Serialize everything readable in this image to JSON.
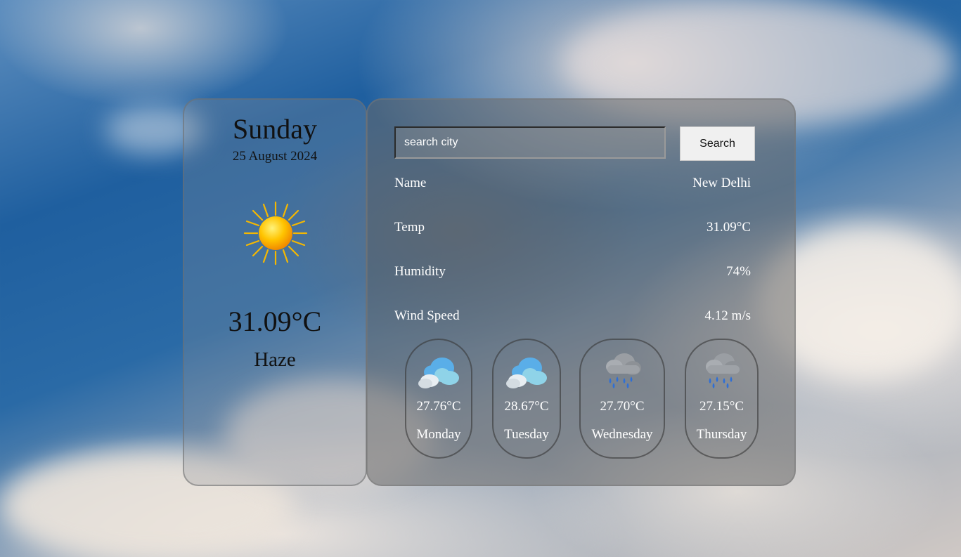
{
  "today": {
    "day": "Sunday",
    "date": "25 August 2024",
    "icon": "sun-icon",
    "temperature": "31.09°C",
    "condition": "Haze"
  },
  "search": {
    "placeholder": "search city",
    "value": "",
    "button_label": "Search"
  },
  "details": [
    {
      "label": "Name",
      "value": "New Delhi"
    },
    {
      "label": "Temp",
      "value": "31.09°C"
    },
    {
      "label": "Humidity",
      "value": "74%"
    },
    {
      "label": "Wind Speed",
      "value": "4.12 m/s"
    }
  ],
  "forecast": [
    {
      "icon": "cloud-icon",
      "temp": "27.76°C",
      "day": "Monday"
    },
    {
      "icon": "cloud-icon",
      "temp": "28.67°C",
      "day": "Tuesday"
    },
    {
      "icon": "rain-cloud-icon",
      "temp": "27.70°C",
      "day": "Wednesday"
    },
    {
      "icon": "rain-cloud-icon",
      "temp": "27.15°C",
      "day": "Thursday"
    }
  ],
  "colors": {
    "card_border": "#6e6e6e",
    "button_bg": "#f0f0f0",
    "sun_core": "#ffc400",
    "sun_rays": "#f5b800",
    "cloud_blue": "#5aaee8",
    "cloud_white": "#e8eef2",
    "rain_drop": "#2f6fd6"
  }
}
